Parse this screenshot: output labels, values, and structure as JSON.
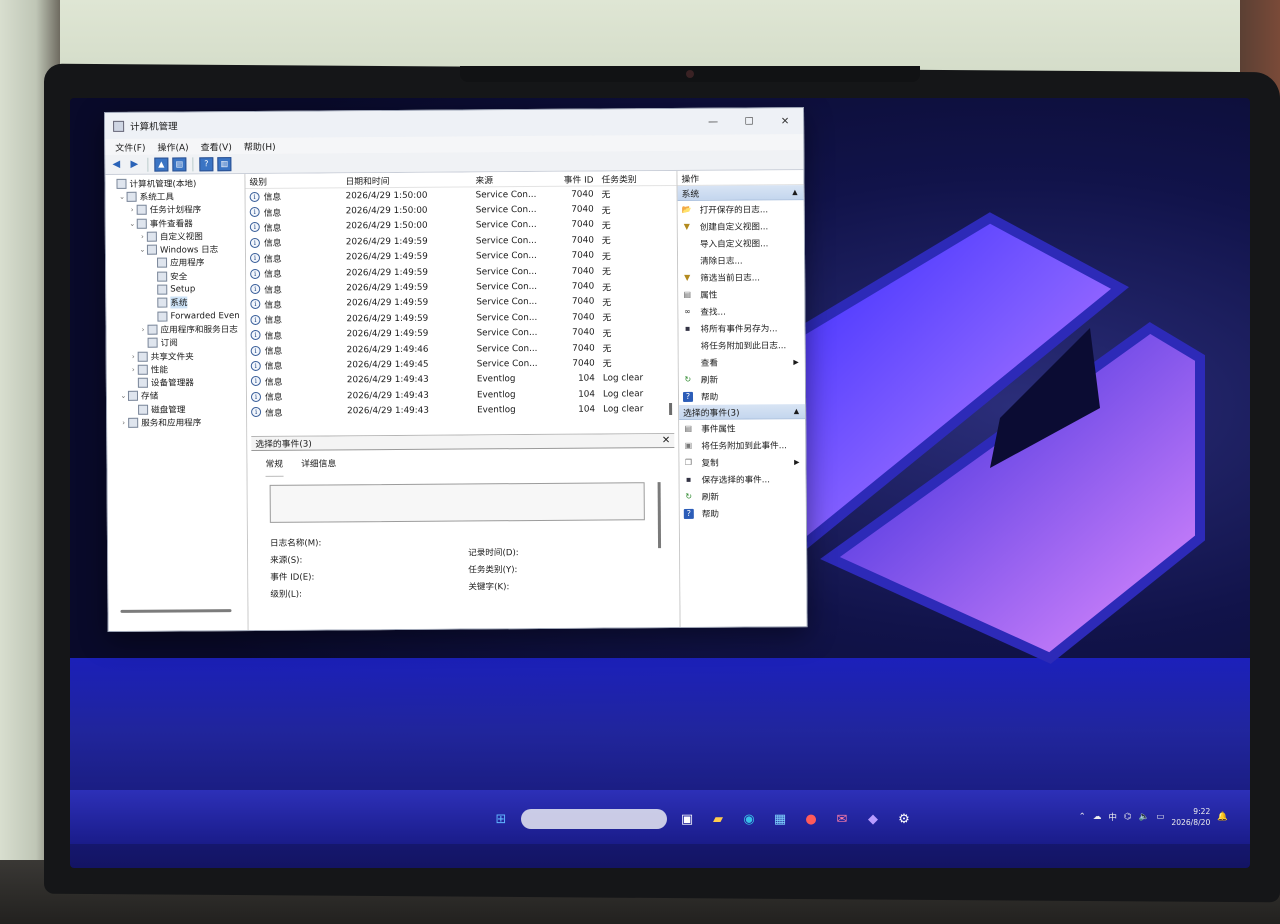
{
  "window": {
    "title": "计算机管理",
    "controls": {
      "minimize": "—",
      "maximize": "☐",
      "close": "✕"
    }
  },
  "menu": [
    "文件(F)",
    "操作(A)",
    "查看(V)",
    "帮助(H)"
  ],
  "tree": {
    "items": [
      {
        "label": "计算机管理(本地)",
        "indent": 0,
        "twisty": ""
      },
      {
        "label": "系统工具",
        "indent": 1,
        "twisty": "⌄"
      },
      {
        "label": "任务计划程序",
        "indent": 2,
        "twisty": "›"
      },
      {
        "label": "事件查看器",
        "indent": 2,
        "twisty": "⌄"
      },
      {
        "label": "自定义视图",
        "indent": 3,
        "twisty": "›"
      },
      {
        "label": "Windows 日志",
        "indent": 3,
        "twisty": "⌄"
      },
      {
        "label": "应用程序",
        "indent": 4,
        "twisty": ""
      },
      {
        "label": "安全",
        "indent": 4,
        "twisty": ""
      },
      {
        "label": "Setup",
        "indent": 4,
        "twisty": ""
      },
      {
        "label": "系统",
        "indent": 4,
        "twisty": "",
        "selected": true
      },
      {
        "label": "Forwarded Even",
        "indent": 4,
        "twisty": ""
      },
      {
        "label": "应用程序和服务日志",
        "indent": 3,
        "twisty": "›"
      },
      {
        "label": "订阅",
        "indent": 3,
        "twisty": ""
      },
      {
        "label": "共享文件夹",
        "indent": 2,
        "twisty": "›"
      },
      {
        "label": "性能",
        "indent": 2,
        "twisty": "›"
      },
      {
        "label": "设备管理器",
        "indent": 2,
        "twisty": ""
      },
      {
        "label": "存储",
        "indent": 1,
        "twisty": "⌄"
      },
      {
        "label": "磁盘管理",
        "indent": 2,
        "twisty": ""
      },
      {
        "label": "服务和应用程序",
        "indent": 1,
        "twisty": "›"
      }
    ]
  },
  "events": {
    "columns": {
      "level": "级别",
      "date": "日期和时间",
      "source": "来源",
      "id": "事件 ID",
      "category": "任务类别"
    },
    "rows": [
      {
        "level": "信息",
        "date": "2026/4/29 1:50:00",
        "source": "Service Con...",
        "id": "7040",
        "category": "无"
      },
      {
        "level": "信息",
        "date": "2026/4/29 1:50:00",
        "source": "Service Con...",
        "id": "7040",
        "category": "无"
      },
      {
        "level": "信息",
        "date": "2026/4/29 1:50:00",
        "source": "Service Con...",
        "id": "7040",
        "category": "无"
      },
      {
        "level": "信息",
        "date": "2026/4/29 1:49:59",
        "source": "Service Con...",
        "id": "7040",
        "category": "无"
      },
      {
        "level": "信息",
        "date": "2026/4/29 1:49:59",
        "source": "Service Con...",
        "id": "7040",
        "category": "无"
      },
      {
        "level": "信息",
        "date": "2026/4/29 1:49:59",
        "source": "Service Con...",
        "id": "7040",
        "category": "无"
      },
      {
        "level": "信息",
        "date": "2026/4/29 1:49:59",
        "source": "Service Con...",
        "id": "7040",
        "category": "无"
      },
      {
        "level": "信息",
        "date": "2026/4/29 1:49:59",
        "source": "Service Con...",
        "id": "7040",
        "category": "无"
      },
      {
        "level": "信息",
        "date": "2026/4/29 1:49:59",
        "source": "Service Con...",
        "id": "7040",
        "category": "无"
      },
      {
        "level": "信息",
        "date": "2026/4/29 1:49:59",
        "source": "Service Con...",
        "id": "7040",
        "category": "无"
      },
      {
        "level": "信息",
        "date": "2026/4/29 1:49:46",
        "source": "Service Con...",
        "id": "7040",
        "category": "无"
      },
      {
        "level": "信息",
        "date": "2026/4/29 1:49:45",
        "source": "Service Con...",
        "id": "7040",
        "category": "无"
      },
      {
        "level": "信息",
        "date": "2026/4/29 1:49:43",
        "source": "Eventlog",
        "id": "104",
        "category": "Log clear"
      },
      {
        "level": "信息",
        "date": "2026/4/29 1:49:43",
        "source": "Eventlog",
        "id": "104",
        "category": "Log clear"
      },
      {
        "level": "信息",
        "date": "2026/4/29 1:49:43",
        "source": "Eventlog",
        "id": "104",
        "category": "Log clear"
      }
    ]
  },
  "detail": {
    "header": "选择的事件(3)",
    "close": "✕",
    "tabs": [
      "常规",
      "详细信息"
    ],
    "fields": {
      "log_name": "日志名称(M):",
      "source": "来源(S):",
      "event_id": "事件 ID(E):",
      "level": "级别(L):",
      "logged": "记录时间(D):",
      "task_category": "任务类别(Y):",
      "keywords": "关键字(K):"
    }
  },
  "actions": {
    "header": "操作",
    "section1": {
      "title": "系统",
      "items": [
        {
          "label": "打开保存的日志...",
          "icon": "folder-icon"
        },
        {
          "label": "创建自定义视图...",
          "icon": "filter-icon"
        },
        {
          "label": "导入自定义视图...",
          "icon": ""
        },
        {
          "label": "清除日志...",
          "icon": ""
        },
        {
          "label": "筛选当前日志...",
          "icon": "filter-icon"
        },
        {
          "label": "属性",
          "icon": "properties-icon"
        },
        {
          "label": "查找...",
          "icon": "binoculars-icon"
        },
        {
          "label": "将所有事件另存为...",
          "icon": "save-icon"
        },
        {
          "label": "将任务附加到此日志...",
          "icon": ""
        },
        {
          "label": "查看",
          "icon": "",
          "submenu": true
        },
        {
          "label": "刷新",
          "icon": "refresh-icon"
        },
        {
          "label": "帮助",
          "icon": "help-icon"
        }
      ]
    },
    "section2": {
      "title": "选择的事件(3)",
      "items": [
        {
          "label": "事件属性",
          "icon": "properties-icon"
        },
        {
          "label": "将任务附加到此事件...",
          "icon": "task-icon"
        },
        {
          "label": "复制",
          "icon": "copy-icon",
          "submenu": true
        },
        {
          "label": "保存选择的事件...",
          "icon": "save-icon"
        },
        {
          "label": "刷新",
          "icon": "refresh-icon"
        },
        {
          "label": "帮助",
          "icon": "help-icon"
        }
      ]
    }
  },
  "taskbar": {
    "ime": "中",
    "clock_time": "9:22",
    "clock_date": "2026/8/20"
  },
  "colors": {
    "selection": "#cde3f7",
    "section_bar": "#c4d6ee",
    "wallpaper_glow": "#6b3cff"
  }
}
